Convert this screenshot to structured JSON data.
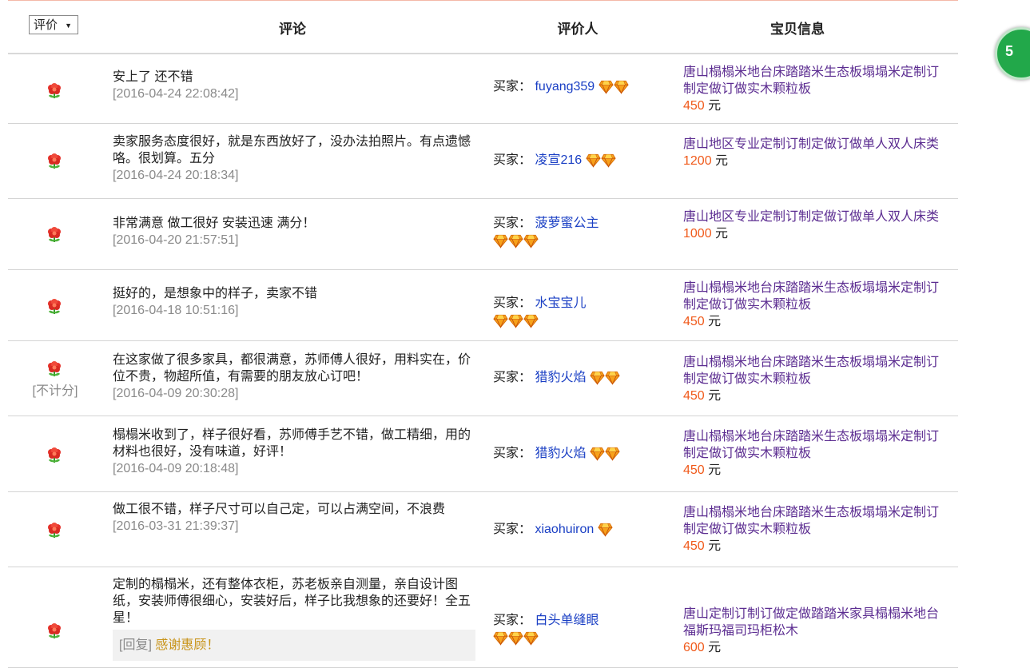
{
  "header": {
    "rating_select": "评价",
    "col_comment": "评论",
    "col_reviewer": "评价人",
    "col_item": "宝贝信息"
  },
  "colors": {
    "accent": "#f05a1b",
    "item_link": "#5c2d91",
    "user_link": "#1a3fc4",
    "reply": "#c8941a"
  },
  "side_badge": {
    "text": "5"
  },
  "buyer_prefix": "买家：",
  "currency": "元",
  "rows": [
    {
      "comment": "安上了 还不错",
      "date": "[2016-04-24 22:08:42]",
      "buyer": "fuyang359",
      "diamonds": 2,
      "item": "唐山榻榻米地台床踏踏米生态板塌塌米定制订制定做订做实木颗粒板",
      "price": "450"
    },
    {
      "comment": "卖家服务态度很好，就是东西放好了，没办法拍照片。有点遗憾咯。很划算。五分",
      "date": "[2016-04-24 20:18:34]",
      "buyer": "凌宣216",
      "diamonds": 2,
      "item": "唐山地区专业定制订制定做订做单人双人床类",
      "price": "1200"
    },
    {
      "comment": "非常满意 做工很好 安装迅速 满分！",
      "date": "[2016-04-20 21:57:51]",
      "buyer": "菠萝蜜公主",
      "diamonds": 3,
      "item": "唐山地区专业定制订制定做订做单人双人床类",
      "price": "1000"
    },
    {
      "comment": "挺好的，是想象中的样子，卖家不错",
      "date": "[2016-04-18 10:51:16]",
      "buyer": "水宝宝儿",
      "diamonds": 3,
      "item": "唐山榻榻米地台床踏踏米生态板塌塌米定制订制定做订做实木颗粒板",
      "price": "450"
    },
    {
      "comment": "在这家做了很多家具，都很满意，苏师傅人很好，用料实在，价位不贵，物超所值，有需要的朋友放心订吧！",
      "date": "[2016-04-09 20:30:28]",
      "buyer": "猎豹火焰",
      "diamonds": 2,
      "no_count": "[不计分]",
      "item": "唐山榻榻米地台床踏踏米生态板塌塌米定制订制定做订做实木颗粒板",
      "price": "450"
    },
    {
      "comment": "榻榻米收到了，样子很好看，苏师傅手艺不错，做工精细，用的材料也很好，没有味道，好评！",
      "date": "[2016-04-09 20:18:48]",
      "buyer": "猎豹火焰",
      "diamonds": 2,
      "item": "唐山榻榻米地台床踏踏米生态板塌塌米定制订制定做订做实木颗粒板",
      "price": "450"
    },
    {
      "comment": "做工很不错，样子尺寸可以自己定，可以占满空间，不浪费",
      "date": "[2016-03-31 21:39:37]",
      "buyer": "xiaohuiron",
      "diamonds": 1,
      "item": "唐山榻榻米地台床踏踏米生态板塌塌米定制订制定做订做实木颗粒板",
      "price": "450"
    },
    {
      "comment": "定制的榻榻米，还有整体衣柜，苏老板亲自测量，亲自设计图纸，安装师傅很细心，安装好后，样子比我想象的还要好！全五星！",
      "reply_label": "[回复]",
      "reply_text": "感谢惠顾！",
      "buyer": "白头单缝眼",
      "diamonds": 3,
      "item": "唐山定制订制订做定做踏踏米家具榻榻米地台福斯玛福司玛柜松木",
      "price": "600"
    }
  ]
}
